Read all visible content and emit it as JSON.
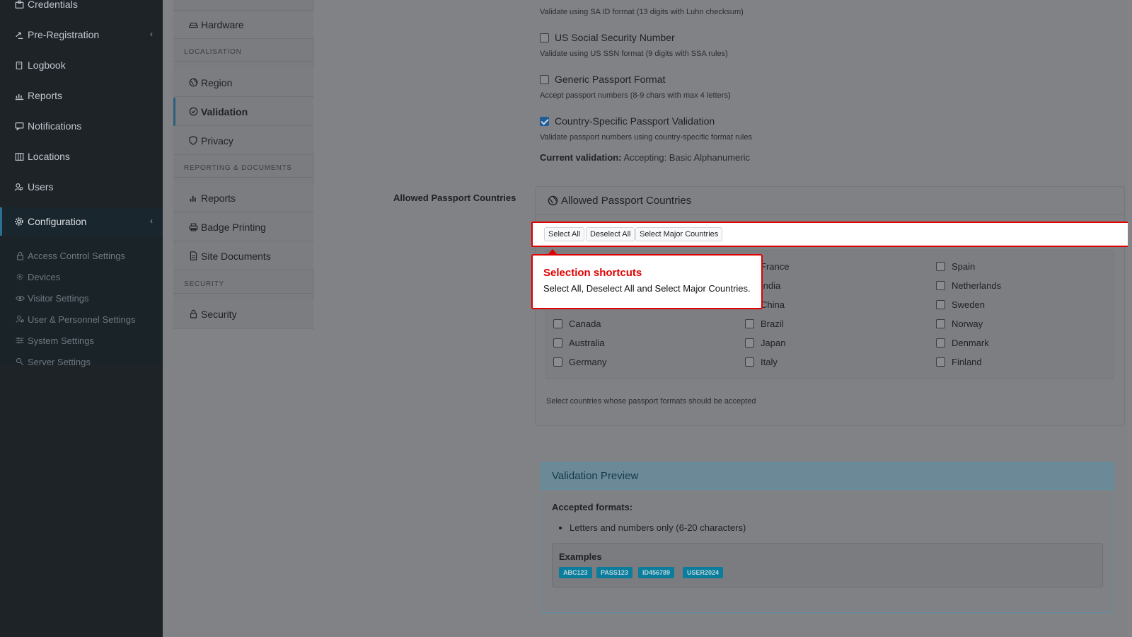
{
  "sidebar": {
    "items": [
      {
        "label": "Credentials",
        "icon": "id-card-icon"
      },
      {
        "label": "Pre-Registration",
        "icon": "arrows-icon",
        "chevron": "‹"
      },
      {
        "label": "Logbook",
        "icon": "book-icon"
      },
      {
        "label": "Reports",
        "icon": "chart-icon"
      },
      {
        "label": "Notifications",
        "icon": "chat-icon"
      },
      {
        "label": "Locations",
        "icon": "map-icon"
      },
      {
        "label": "Users",
        "icon": "users-icon"
      },
      {
        "label": "Configuration",
        "icon": "gear-icon",
        "chevron": "‹"
      }
    ],
    "subitems": [
      {
        "label": "Access Control Settings",
        "icon": "lock-icon"
      },
      {
        "label": "Devices",
        "icon": "device-icon"
      },
      {
        "label": "Visitor Settings",
        "icon": "eye-icon"
      },
      {
        "label": "User & Personnel Settings",
        "icon": "user-cog-icon"
      },
      {
        "label": "System Settings",
        "icon": "sliders-icon"
      },
      {
        "label": "Server Settings",
        "icon": "server-icon"
      }
    ]
  },
  "settings_nav": {
    "items": [
      {
        "label": "Hardware",
        "icon": "hardware-icon"
      },
      {
        "label": "Region",
        "icon": "globe-icon"
      },
      {
        "label": "Validation",
        "icon": "check-circle-icon"
      },
      {
        "label": "Privacy",
        "icon": "shield-icon"
      },
      {
        "label": "Reports",
        "icon": "bar-chart-icon"
      },
      {
        "label": "Badge Printing",
        "icon": "printer-icon"
      },
      {
        "label": "Site Documents",
        "icon": "document-icon"
      },
      {
        "label": "Security",
        "icon": "lock-icon"
      }
    ],
    "sections": {
      "localisation": "LOCALISATION",
      "reporting": "REPORTING & DOCUMENTS",
      "security": "SECURITY"
    }
  },
  "validation": {
    "sa_hint": "Validate using SA ID format (13 digits with Luhn checksum)",
    "options": [
      {
        "label": "US Social Security Number",
        "hint": "Validate using US SSN format (9 digits with SSA rules)",
        "checked": false
      },
      {
        "label": "Generic Passport Format",
        "hint": "Accept passport numbers (8-9 chars with max 4 letters)",
        "checked": false
      },
      {
        "label": "Country-Specific Passport Validation",
        "hint": "Validate passport numbers using country-specific format rules",
        "checked": true
      }
    ],
    "current_label": "Current validation:",
    "current_value": "Accepting: Basic Alphanumeric"
  },
  "passport": {
    "row_label": "Allowed Passport Countries",
    "card_title": "Allowed Passport Countries",
    "buttons": {
      "select_all": "Select All",
      "deselect_all": "Deselect All",
      "select_major": "Select Major Countries"
    },
    "countries_col1": [
      "Canada",
      "Australia",
      "Germany"
    ],
    "countries_col2": [
      "France",
      "India",
      "China",
      "Brazil",
      "Japan",
      "Italy"
    ],
    "countries_col3": [
      "Spain",
      "Netherlands",
      "Sweden",
      "Norway",
      "Denmark",
      "Finland"
    ],
    "footer": "Select countries whose passport formats should be accepted"
  },
  "tooltip": {
    "title": "Selection shortcuts",
    "body": "Select All, Deselect All and Select Major Countries."
  },
  "preview": {
    "title": "Validation Preview",
    "accepted_label": "Accepted formats:",
    "formats": [
      "Letters and numbers only (6-20 characters)"
    ],
    "examples_label": "Examples",
    "examples": [
      "ABC123",
      "PASS123",
      "ID456789",
      "USER2024"
    ]
  },
  "colors": {
    "highlight": "#e00000",
    "badge": "#0b7d9c",
    "sidebar_bg": "#1d2327"
  }
}
